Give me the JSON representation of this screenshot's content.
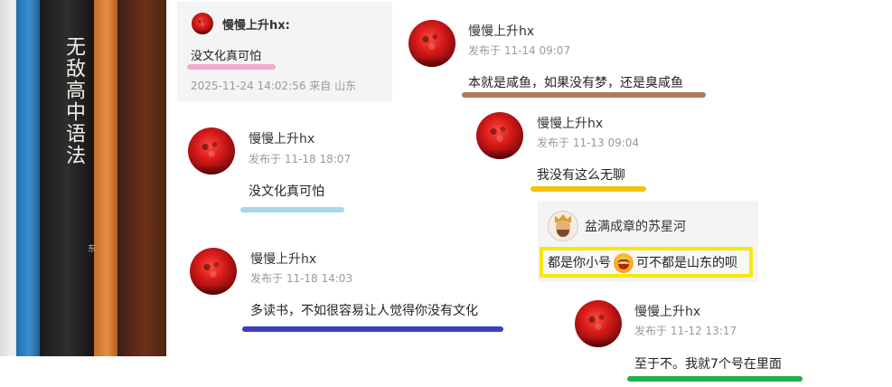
{
  "book_photo": {
    "spine_title": "无敌高中语法",
    "spine_small": "东"
  },
  "reply_card": {
    "user": "慢慢上升hx:",
    "text": "没文化真可怕",
    "meta": "2025-11-24 14:02:56   来自 山东",
    "underline_color": "#f7a9cc"
  },
  "post_left_1": {
    "user": "慢慢上升hx",
    "meta": "发布于 11-18 18:07",
    "text": "没文化真可怕",
    "underline_color": "#a6d8ea"
  },
  "post_left_2": {
    "user": "慢慢上升hx",
    "meta": "发布于 11-18 14:03",
    "text": "多读书，不如很容易让人觉得你没有文化",
    "underline_color": "#3b3fbf"
  },
  "post_right_1": {
    "user": "慢慢上升hx",
    "meta": "发布于 11-14 09:07",
    "text": "本就是咸鱼，如果没有梦，还是臭咸鱼",
    "underline_color": "#b07a5a"
  },
  "post_right_2": {
    "user": "慢慢上升hx",
    "meta": "发布于 11-13 09:04",
    "text": "我没有这么无聊",
    "underline_color": "#f2c30a"
  },
  "quote_card": {
    "user": "盆满成章的苏星河",
    "text_before": "都是你小号",
    "text_after": "可不都是山东的呗",
    "box_color": "#f7e80b"
  },
  "post_right_3": {
    "user": "慢慢上升hx",
    "meta": "发布于 11-12 13:17",
    "text": "至于不。我就7个号在里面",
    "underline_color": "#22b04a"
  }
}
